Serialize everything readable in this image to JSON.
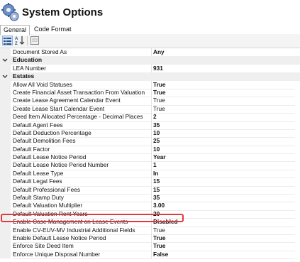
{
  "header": {
    "title": "System Options"
  },
  "tabs": [
    {
      "label": "General"
    },
    {
      "label": "Code Format"
    }
  ],
  "grid": {
    "rows": [
      {
        "type": "prop",
        "name": "Document Stored As",
        "value": "Any",
        "bold": true
      },
      {
        "type": "cat",
        "name": "Education"
      },
      {
        "type": "prop",
        "name": "LEA Number",
        "value": "931",
        "bold": true
      },
      {
        "type": "cat",
        "name": "Estates"
      },
      {
        "type": "prop",
        "name": "Allow All Void Statuses",
        "value": "True",
        "bold": true
      },
      {
        "type": "prop",
        "name": "Create Financial Asset Transaction From Valuation",
        "value": "True",
        "bold": true
      },
      {
        "type": "prop",
        "name": "Create Lease Agreement Calendar Event",
        "value": "True",
        "bold": false
      },
      {
        "type": "prop",
        "name": "Create Lease Start Calendar Event",
        "value": "True",
        "bold": false
      },
      {
        "type": "prop",
        "name": "Deed Item Allocated Percentage - Decimal Places",
        "value": "2",
        "bold": true
      },
      {
        "type": "prop",
        "name": "Default Agent Fees",
        "value": "35",
        "bold": true
      },
      {
        "type": "prop",
        "name": "Default Deduction Percentage",
        "value": "10",
        "bold": true
      },
      {
        "type": "prop",
        "name": "Default Demolition Fees",
        "value": "25",
        "bold": true
      },
      {
        "type": "prop",
        "name": "Default Factor",
        "value": "10",
        "bold": true
      },
      {
        "type": "prop",
        "name": "Default Lease Notice Period",
        "value": "Year",
        "bold": true
      },
      {
        "type": "prop",
        "name": "Default Lease Notice Period Number",
        "value": "1",
        "bold": true
      },
      {
        "type": "prop",
        "name": "Default Lease Type",
        "value": "In",
        "bold": true
      },
      {
        "type": "prop",
        "name": "Default Legal Fees",
        "value": "15",
        "bold": true
      },
      {
        "type": "prop",
        "name": "Default Professional Fees",
        "value": "15",
        "bold": true
      },
      {
        "type": "prop",
        "name": "Default Stamp Duty",
        "value": "35",
        "bold": true
      },
      {
        "type": "prop",
        "name": "Default Valuation Multiplier",
        "value": "3.00",
        "bold": true
      },
      {
        "type": "prop",
        "name": "Default Valuation Rent Years",
        "value": "20",
        "bold": true
      },
      {
        "type": "prop",
        "name": "Enable Case Management on Lease Events",
        "value": "Disabled",
        "bold": true
      },
      {
        "type": "prop",
        "name": "Enable CV-EUV-MV Industrial Additional Fields",
        "value": "True",
        "bold": false
      },
      {
        "type": "prop",
        "name": "Enable Default Lease Notice Period",
        "value": "True",
        "bold": true
      },
      {
        "type": "prop",
        "name": "Enforce Site Deed Item",
        "value": "True",
        "bold": true
      },
      {
        "type": "prop",
        "name": "Enforce Unique Disposal Number",
        "value": "False",
        "bold": true
      }
    ]
  },
  "colors": {
    "highlight": "#e0393e",
    "margin": "#efefef"
  }
}
